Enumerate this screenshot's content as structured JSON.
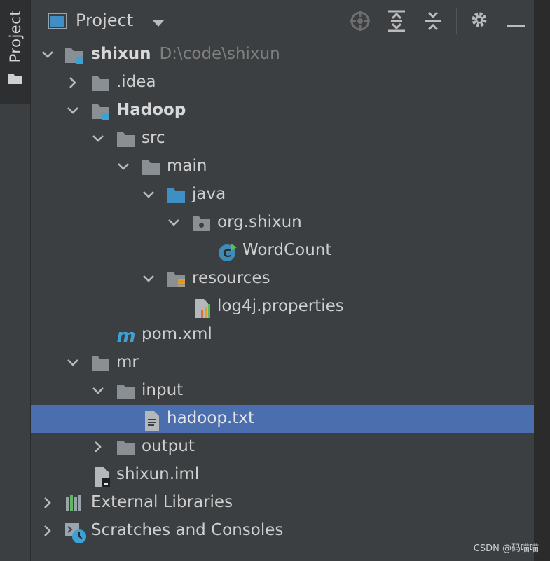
{
  "sidebar_tab": {
    "label": "Project"
  },
  "toolbar": {
    "title": "Project"
  },
  "tree": {
    "root": {
      "label": "shixun",
      "path": "D:\\code\\shixun"
    },
    "idea": {
      "label": ".idea"
    },
    "hadoop": {
      "label": "Hadoop"
    },
    "src": {
      "label": "src"
    },
    "main": {
      "label": "main"
    },
    "java": {
      "label": "java"
    },
    "pkg": {
      "label": "org.shixun"
    },
    "wordcount": {
      "label": "WordCount"
    },
    "resources": {
      "label": "resources"
    },
    "log4j": {
      "label": "log4j.properties"
    },
    "pom": {
      "label": "pom.xml"
    },
    "mr": {
      "label": "mr"
    },
    "input": {
      "label": "input"
    },
    "hadooptxt": {
      "label": "hadoop.txt"
    },
    "output": {
      "label": "output"
    },
    "iml": {
      "label": "shixun.iml"
    },
    "extlibs": {
      "label": "External Libraries"
    },
    "scratches": {
      "label": "Scratches and Consoles"
    }
  },
  "colors": {
    "background": "#3c3f41",
    "selection": "#4b6eaf",
    "folder": "#8a8f94",
    "module_badge": "#3ea1d6"
  },
  "watermark": "CSDN @码喵喵"
}
